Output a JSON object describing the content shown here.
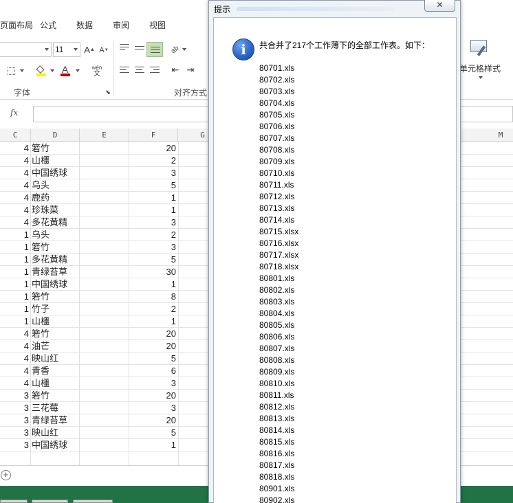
{
  "ribbon": {
    "tabs": [
      "页面布局",
      "公式",
      "数据",
      "审阅",
      "视图"
    ],
    "font_size": "11",
    "grow_font": "A",
    "shrink_font": "A",
    "wen_label": "wén",
    "wen_char": "文",
    "font_color_letter": "A",
    "group_font": "字体",
    "group_align": "对齐方式",
    "cell_styles": "单元格样式"
  },
  "formula_bar": {
    "fx": "fx",
    "value": ""
  },
  "columns": [
    "C",
    "D",
    "E",
    "F",
    "G",
    "M"
  ],
  "rows": [
    {
      "c": "4",
      "d": "箬竹",
      "f": "20"
    },
    {
      "c": "4",
      "d": "山橿",
      "f": "2"
    },
    {
      "c": "4",
      "d": "中国绣球",
      "f": "3"
    },
    {
      "c": "4",
      "d": "乌头",
      "f": "5"
    },
    {
      "c": "4",
      "d": "鹿药",
      "f": "1"
    },
    {
      "c": "4",
      "d": "珍珠菜",
      "f": "1"
    },
    {
      "c": "4",
      "d": "多花黄精",
      "f": "3"
    },
    {
      "c": "1",
      "d": "乌头",
      "f": "2"
    },
    {
      "c": "1",
      "d": "箬竹",
      "f": "3"
    },
    {
      "c": "1",
      "d": "多花黄精",
      "f": "5"
    },
    {
      "c": "1",
      "d": "青绿苔草",
      "f": "30"
    },
    {
      "c": "1",
      "d": "中国绣球",
      "f": "1"
    },
    {
      "c": "1",
      "d": "箬竹",
      "f": "8"
    },
    {
      "c": "1",
      "d": "竹子",
      "f": "2"
    },
    {
      "c": "1",
      "d": "山橿",
      "f": "1"
    },
    {
      "c": "4",
      "d": "箬竹",
      "f": "20"
    },
    {
      "c": "4",
      "d": "油芒",
      "f": "20"
    },
    {
      "c": "4",
      "d": "映山红",
      "f": "5"
    },
    {
      "c": "4",
      "d": "青香",
      "f": "6"
    },
    {
      "c": "4",
      "d": "山橿",
      "f": "3"
    },
    {
      "c": "3",
      "d": "箬竹",
      "f": "20"
    },
    {
      "c": "3",
      "d": "三花莓",
      "f": "3"
    },
    {
      "c": "3",
      "d": "青绿苔草",
      "f": "20"
    },
    {
      "c": "3",
      "d": "映山红",
      "f": "5"
    },
    {
      "c": "3",
      "d": "中国绣球",
      "f": "1"
    }
  ],
  "dialog": {
    "title": "提示",
    "close": "✕",
    "icon": "i",
    "message": "共合并了217个工作薄下的全部工作表。如下：",
    "files": [
      "80701.xls",
      "80702.xls",
      "80703.xls",
      "80704.xls",
      "80705.xls",
      "80706.xls",
      "80707.xls",
      "80708.xls",
      "80709.xls",
      "80710.xls",
      "80711.xls",
      "80712.xls",
      "80713.xls",
      "80714.xls",
      "80715.xlsx",
      "80716.xlsx",
      "80717.xlsx",
      "80718.xlsx",
      "80801.xls",
      "80802.xls",
      "80803.xls",
      "80804.xls",
      "80805.xls",
      "80806.xls",
      "80807.xls",
      "80808.xls",
      "80809.xls",
      "80810.xls",
      "80811.xls",
      "80812.xls",
      "80813.xls",
      "80814.xls",
      "80815.xls",
      "80816.xls",
      "80817.xls",
      "80818.xls",
      "80901.xls",
      "80902.xls"
    ]
  },
  "icons": {
    "info": "info-icon",
    "close": "close-icon",
    "add_sheet": "plus-circle-icon",
    "add_symbol": "+",
    "indent": "⇤",
    "outdent": "⇥",
    "group_launcher": "⬊"
  },
  "colors": {
    "status_bar": "#217346",
    "info_blue": "#2d67c5",
    "highlight_yellow": "#ffef00",
    "font_red": "#c00000"
  }
}
